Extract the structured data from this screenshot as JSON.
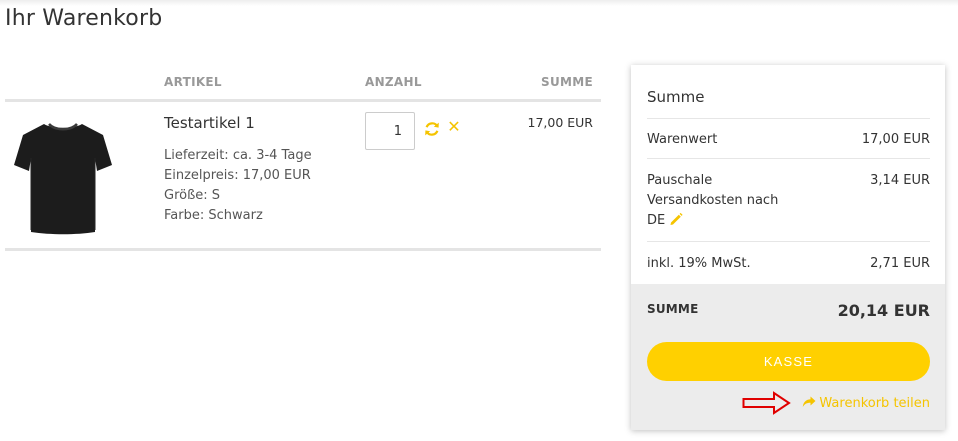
{
  "page": {
    "title": "Ihr Warenkorb"
  },
  "cart": {
    "headers": {
      "artikel": "ARTIKEL",
      "anzahl": "ANZAHL",
      "summe": "SUMME"
    },
    "items": [
      {
        "name": "Testartikel 1",
        "details": [
          "Lieferzeit: ca. 3-4 Tage",
          "Einzelpreis: 17,00 EUR",
          "Größe: S",
          "Farbe: Schwarz"
        ],
        "quantity": "1",
        "total": "17,00 EUR",
        "image": "black-tshirt",
        "refresh_icon": "refresh-icon",
        "remove_icon": "close-icon",
        "remove_glyph": "✕"
      }
    ]
  },
  "summary": {
    "title": "Summe",
    "rows": [
      {
        "label": "Warenwert",
        "value": "17,00 EUR"
      },
      {
        "label": "Pauschale Versandkosten nach DE",
        "value": "3,14 EUR"
      },
      {
        "label": "inkl. 19% MwSt.",
        "value": "2,71 EUR"
      }
    ],
    "total_label": "SUMME",
    "total_value": "20,14 EUR",
    "checkout_label": "KASSE",
    "share_label": "Warenkorb teilen"
  },
  "colors": {
    "accent": "#ffd000",
    "link": "#f5c400",
    "annotation": "#e00000"
  },
  "icons": {
    "edit": "pencil-icon",
    "share": "share-arrow-icon",
    "annotation": "red-arrow-icon"
  }
}
